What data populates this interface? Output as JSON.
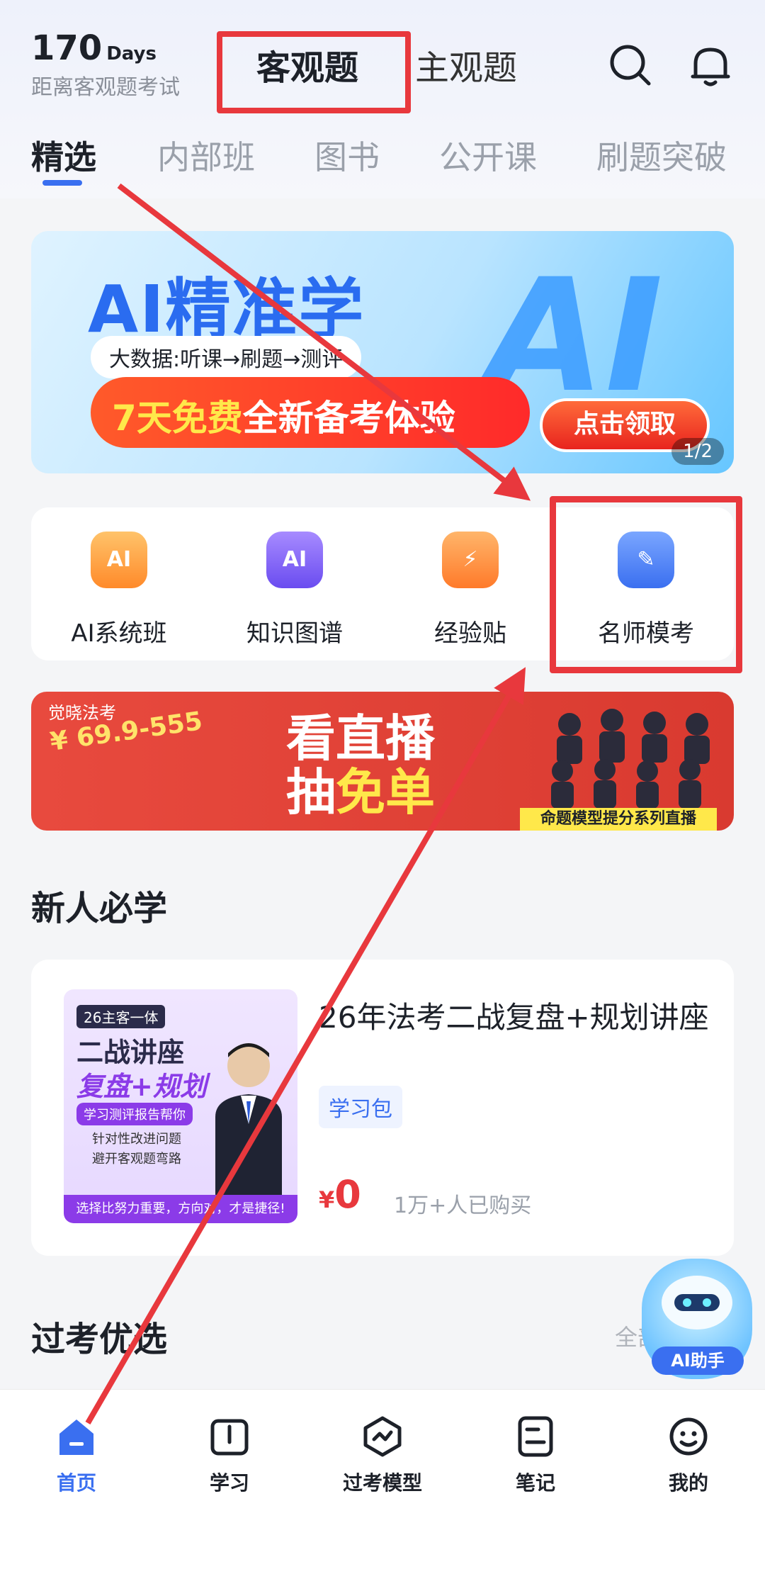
{
  "header": {
    "countdown_number": "170",
    "countdown_unit": "Days",
    "countdown_subtitle": "距离客观题考试",
    "mode_tabs": [
      "客观题",
      "主观题"
    ],
    "icons": [
      "search-icon",
      "bell-icon"
    ]
  },
  "category_tabs": [
    "精选",
    "内部班",
    "图书",
    "公开课",
    "刷题突破"
  ],
  "banner": {
    "title": "AI精准学",
    "pill": "大数据:听课→刷题→测评",
    "promo_highlight": "7天免费",
    "promo_rest": "全新备考体验",
    "big_text": "AI",
    "cta": "点击领取",
    "page_indicator": "1/2"
  },
  "quick_entries": [
    {
      "label": "AI系统班",
      "icon_text": "AI",
      "color": "#ff9a3a"
    },
    {
      "label": "知识图谱",
      "icon_text": "AI",
      "color": "#7b5cf0"
    },
    {
      "label": "经验贴",
      "icon_text": "⚡",
      "color": "#ff8a3a"
    },
    {
      "label": "名师模考",
      "icon_text": "✎",
      "color": "#4a7bf5"
    }
  ],
  "live_banner": {
    "brand": "觉晓法考",
    "price": "¥ 69.9-555",
    "line1": "看直播",
    "line2_prefix": "抽",
    "line2_highlight": "免单",
    "strip": "命题模型提分系列直播"
  },
  "new_user": {
    "section_title": "新人必学",
    "thumb": {
      "tag": "26主客一体",
      "line1": "二战讲座",
      "line2": "复盘+规划",
      "line3": "学习测评报告帮你",
      "line4": "针对性改进问题",
      "line5": "避开客观题弯路",
      "bottom": "选择比努力重要，方向对，才是捷径!"
    },
    "title": "26年法考二战复盘+规划讲座",
    "tag": "学习包",
    "price_symbol": "¥",
    "price_value": "0",
    "buyers": "1万+人已购买"
  },
  "guoka": {
    "section_title": "过考优选",
    "see_all": "全部"
  },
  "ai_assistant": {
    "label": "AI助手"
  },
  "tabbar": [
    {
      "label": "首页",
      "icon": "home-icon",
      "active": true
    },
    {
      "label": "学习",
      "icon": "book-icon",
      "active": false
    },
    {
      "label": "过考模型",
      "icon": "model-icon",
      "active": false
    },
    {
      "label": "笔记",
      "icon": "note-icon",
      "active": false
    },
    {
      "label": "我的",
      "icon": "profile-icon",
      "active": false
    }
  ],
  "colors": {
    "accent": "#3a6ff0",
    "annotation_red": "#e8383d",
    "price_red": "#e8383d"
  }
}
